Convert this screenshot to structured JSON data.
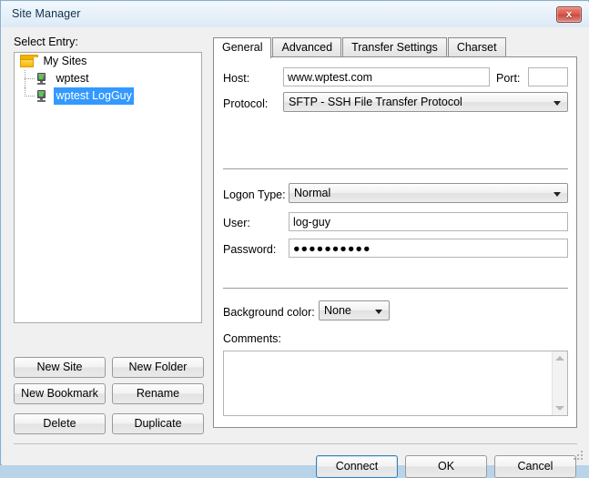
{
  "window": {
    "title": "Site Manager",
    "close_label": "x"
  },
  "left": {
    "select_entry_label": "Select Entry:",
    "tree": [
      {
        "label": "My Sites",
        "icon": "folder-icon",
        "level": 0,
        "selected": false
      },
      {
        "label": "wptest",
        "icon": "server-icon",
        "level": 1,
        "selected": false
      },
      {
        "label": "wptest LogGuy",
        "icon": "server-icon",
        "level": 1,
        "selected": true
      }
    ],
    "buttons": [
      {
        "label": "New Site"
      },
      {
        "label": "New Folder"
      },
      {
        "label": "New Bookmark"
      },
      {
        "label": "Rename"
      },
      {
        "label": "Delete"
      },
      {
        "label": "Duplicate"
      }
    ]
  },
  "tabs": [
    {
      "label": "General",
      "active": true
    },
    {
      "label": "Advanced",
      "active": false
    },
    {
      "label": "Transfer Settings",
      "active": false
    },
    {
      "label": "Charset",
      "active": false
    }
  ],
  "general": {
    "host_label": "Host:",
    "host_value": "www.wptest.com",
    "port_label": "Port:",
    "port_value": "",
    "protocol_label": "Protocol:",
    "protocol_value": "SFTP - SSH File Transfer Protocol",
    "logon_type_label": "Logon Type:",
    "logon_type_value": "Normal",
    "user_label": "User:",
    "user_value": "log-guy",
    "password_label": "Password:",
    "password_value": "●●●●●●●●●●",
    "background_color_label": "Background color:",
    "background_color_value": "None",
    "comments_label": "Comments:",
    "comments_value": ""
  },
  "footer": {
    "connect_label": "Connect",
    "ok_label": "OK",
    "cancel_label": "Cancel"
  },
  "colors": {
    "selection_blue": "#3399ff",
    "focus_blue": "#3c7fb1",
    "close_red": "#d9584c",
    "folder_yellow": "#f0b400",
    "window_bg": "#f0f0f0"
  }
}
